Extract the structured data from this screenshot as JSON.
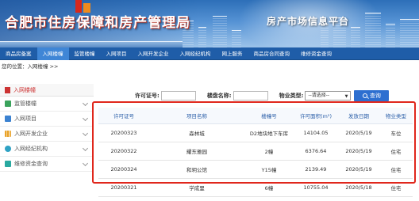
{
  "banner": {
    "title": "合肥市住房保障和房产管理局",
    "subtitle": "房产市场信息平台"
  },
  "nav": {
    "items": [
      "商品房备案",
      "入网楼幢",
      "监管楼幢",
      "入网项目",
      "入网开发企业",
      "入网经纪机构",
      "网上服务",
      "商品房合同查询",
      "维修资金查询"
    ],
    "active_index": 1
  },
  "breadcrumb": "您的位置：入网楼幢 >>",
  "sidebar": {
    "header": "入网楼幢",
    "items": [
      {
        "label": "监管楼幢",
        "icon": "building-icon"
      },
      {
        "label": "入网项目",
        "icon": "home-icon"
      },
      {
        "label": "入网开发企业",
        "icon": "bar-chart-icon"
      },
      {
        "label": "入网经纪机构",
        "icon": "agency-icon"
      },
      {
        "label": "维修资金查询",
        "icon": "search-list-icon"
      }
    ]
  },
  "search": {
    "permit_label": "许可证号:",
    "name_label": "楼盘名称:",
    "type_label": "物业类型:",
    "type_selected": "--请选择--",
    "button_label": "查询"
  },
  "table": {
    "headers": [
      "许可证号",
      "项目名称",
      "楼幢号",
      "许可面积(m²)",
      "发放日期",
      "物业类型"
    ],
    "rows": [
      [
        "20200323",
        "森林城",
        "D2地块地下车库",
        "14104.05",
        "2020/5/19",
        "车位"
      ],
      [
        "20200322",
        "耀东雅园",
        "2幢",
        "6376.64",
        "2020/5/19",
        "住宅"
      ],
      [
        "20200324",
        "和玥公馆",
        "Y15幢",
        "2139.49",
        "2020/5/19",
        "住宅"
      ],
      [
        "20200321",
        "学成里",
        "6幢",
        "10755.04",
        "2020/5/18",
        "住宅"
      ]
    ]
  },
  "colors": {
    "nav_bg": "#1f5da8",
    "nav_active": "#3f86d6",
    "highlight_border": "#e0271c",
    "header_text": "#2a5ea8"
  }
}
